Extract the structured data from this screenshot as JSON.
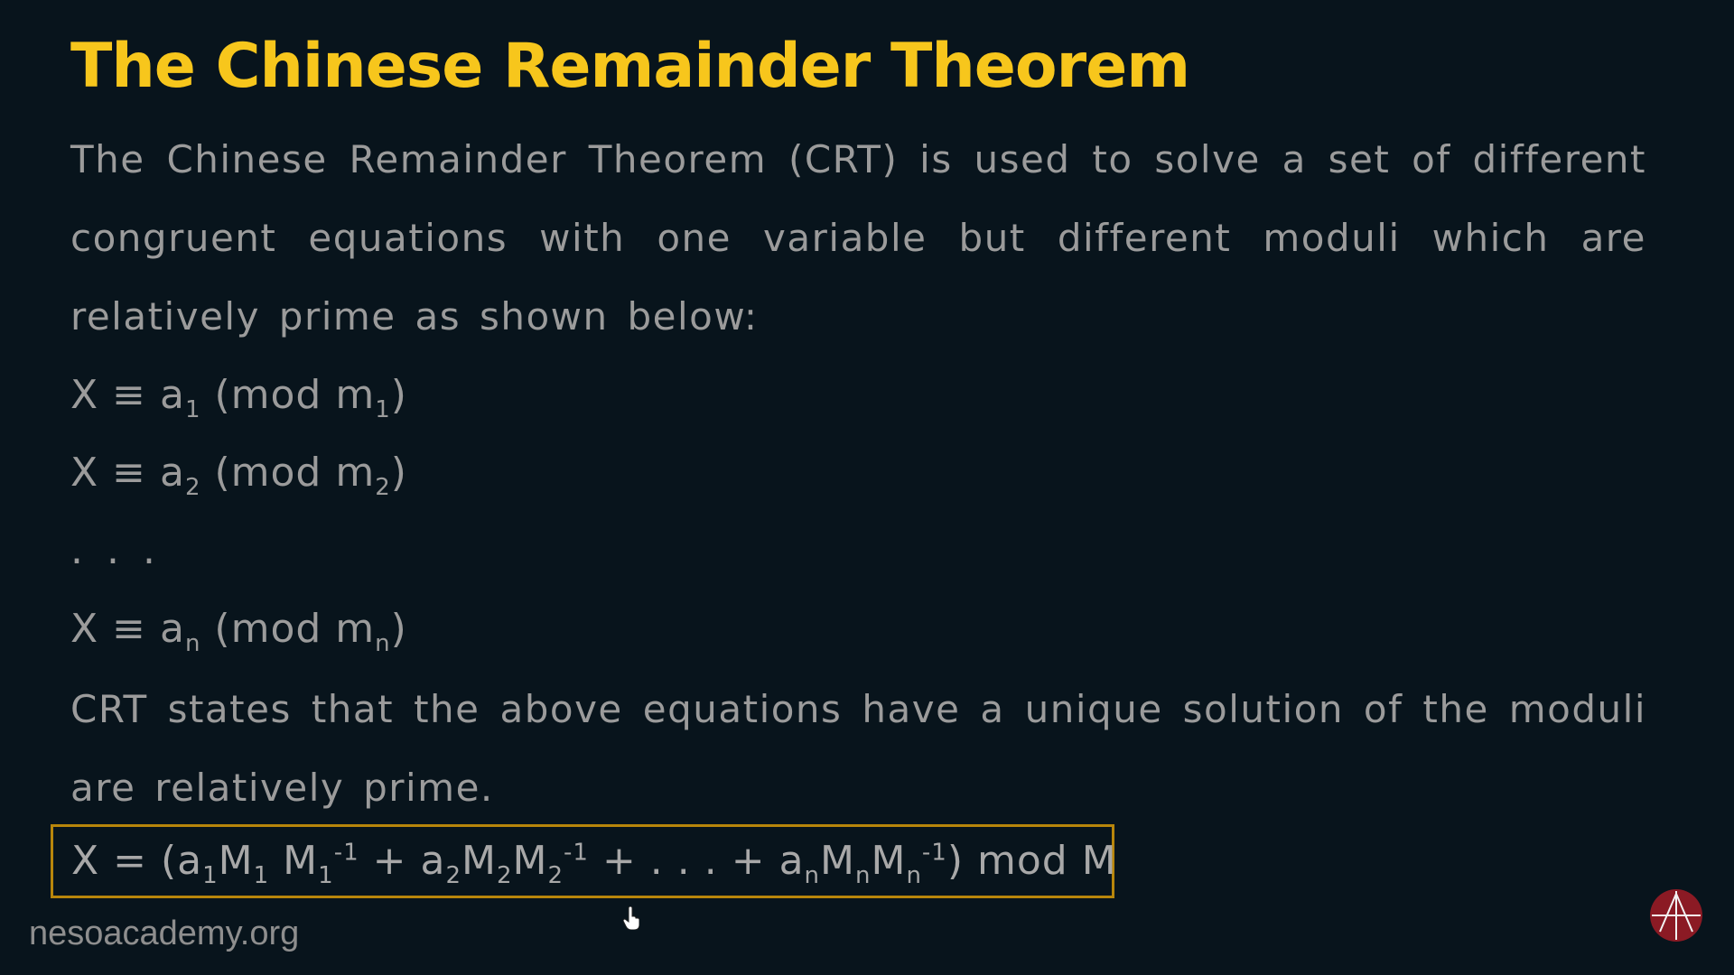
{
  "slide": {
    "title": "The Chinese Remainder Theorem",
    "intro": "The Chinese Remainder Theorem (CRT) is used to solve a set of different congruent equations with one variable but different moduli which are relatively prime as shown below:",
    "equations": [
      {
        "lhs": "X ≡ a",
        "sub1": "1",
        "mid": " (mod m",
        "sub2": "1",
        "end": ")"
      },
      {
        "lhs": "X ≡ a",
        "sub1": "2",
        "mid": " (mod m",
        "sub2": "2",
        "end": ")"
      },
      {
        "ellipsis": ". . ."
      },
      {
        "lhs": "X ≡ a",
        "sub1": "n",
        "mid": " (mod m",
        "sub2": "n",
        "end": ")"
      }
    ],
    "statement": "CRT states that the above equations have a unique solution of the moduli are relatively prime.",
    "formula": {
      "start": "X = (a",
      "t1_sub_a": "1",
      "t1_M": "M",
      "t1_sub_M": "1",
      "t1_Minv": " M",
      "t1_sub_Minv": "1",
      "t1_sup": "-1",
      "plus1": "  + a",
      "t2_sub_a": "2",
      "t2_M": "M",
      "t2_sub_M": "2",
      "t2_Minv": "M",
      "t2_sub_Minv": "2",
      "t2_sup": "-1",
      "middle": " + . . . + a",
      "tn_sub_a": "n",
      "tn_M": "M",
      "tn_sub_M": "n",
      "tn_Minv": "M",
      "tn_sub_Minv": "n",
      "tn_sup": "-1",
      "end": ") mod M"
    },
    "footer": "nesoacademy.org"
  },
  "colors": {
    "background": "#08141c",
    "title": "#f7c61c",
    "text": "#9b9b9b",
    "box_border": "#b8860b",
    "logo": "#8b1a24"
  },
  "icons": {
    "logo": "neso-academy-logo",
    "cursor": "hand-cursor-icon"
  }
}
